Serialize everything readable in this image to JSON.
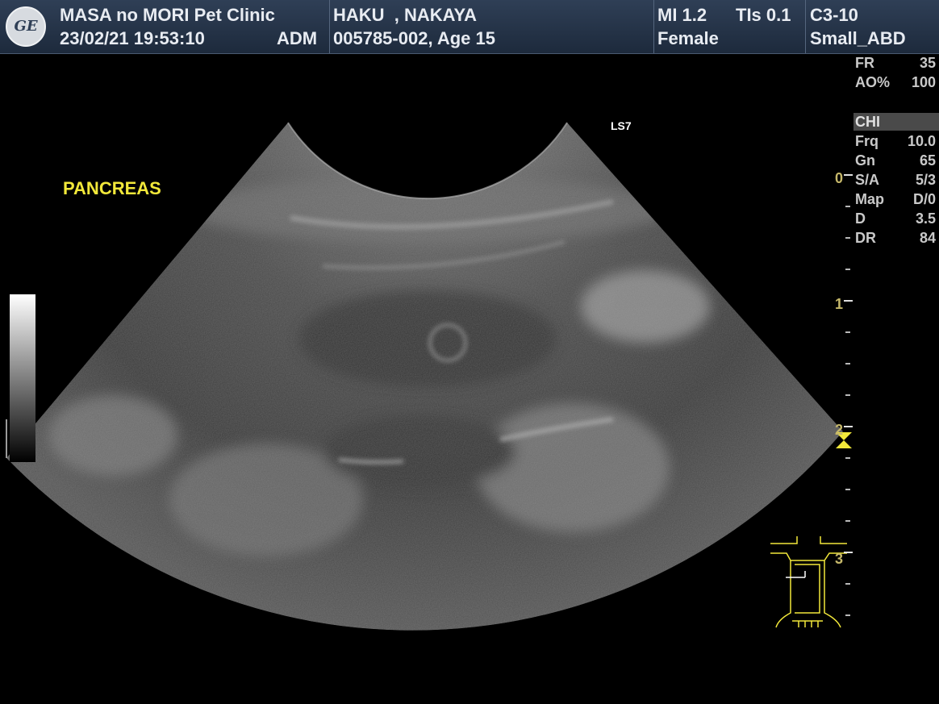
{
  "header": {
    "clinic": "MASA no MORI Pet Clinic",
    "datetime": "23/02/21 19:53:10",
    "operator": "ADM",
    "patient_name": "HAKU  , NAKAYA",
    "patient_id_age": "005785-002, Age 15",
    "mi": "MI 1.2",
    "tis": "TIs 0.1",
    "sex": "Female",
    "probe": "C3-10",
    "preset": "Small_ABD",
    "logo": "GE"
  },
  "image": {
    "organ_label": "PANCREAS",
    "view_label": "LS7"
  },
  "params": [
    {
      "key": "FR",
      "value": "35"
    },
    {
      "key": "AO%",
      "value": "100"
    }
  ],
  "mode": "CHI",
  "params2": [
    {
      "key": "Frq",
      "value": "10.0"
    },
    {
      "key": "Gn",
      "value": "65"
    },
    {
      "key": "S/A",
      "value": "5/3"
    },
    {
      "key": "Map",
      "value": "D/0"
    },
    {
      "key": "D",
      "value": "3.5"
    },
    {
      "key": "DR",
      "value": "84"
    }
  ],
  "depth_scale": {
    "labels": [
      "0",
      "1",
      "2",
      "3"
    ],
    "unit_max": 3.5
  },
  "colors": {
    "header_bg": "#2f3f56",
    "annotation": "#f2e83a",
    "depth_marker": "#f2e83a"
  }
}
